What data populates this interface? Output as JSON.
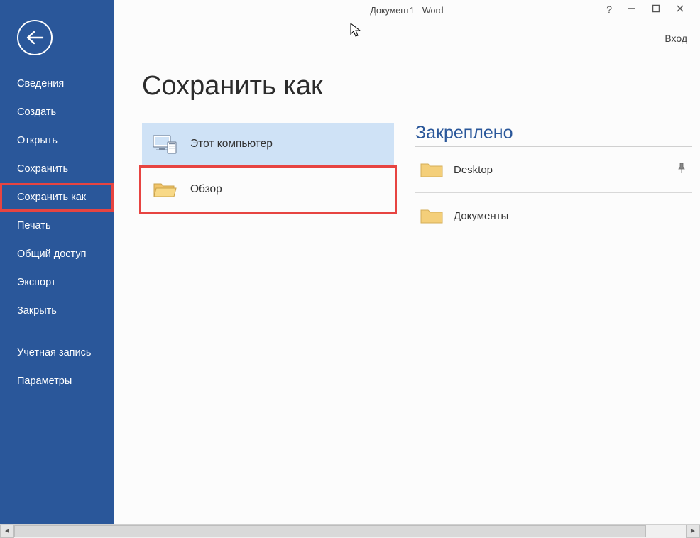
{
  "titlebar": {
    "title": "Документ1 - Word",
    "signin": "Вход"
  },
  "sidebar": {
    "items": [
      "Сведения",
      "Создать",
      "Открыть",
      "Сохранить",
      "Сохранить как",
      "Печать",
      "Общий доступ",
      "Экспорт",
      "Закрыть"
    ],
    "footerItems": [
      "Учетная запись",
      "Параметры"
    ]
  },
  "page": {
    "title": "Сохранить как"
  },
  "locations": {
    "thisPc": "Этот компьютер",
    "browse": "Обзор"
  },
  "pinned": {
    "title": "Закреплено",
    "items": [
      "Desktop",
      "Документы"
    ]
  }
}
